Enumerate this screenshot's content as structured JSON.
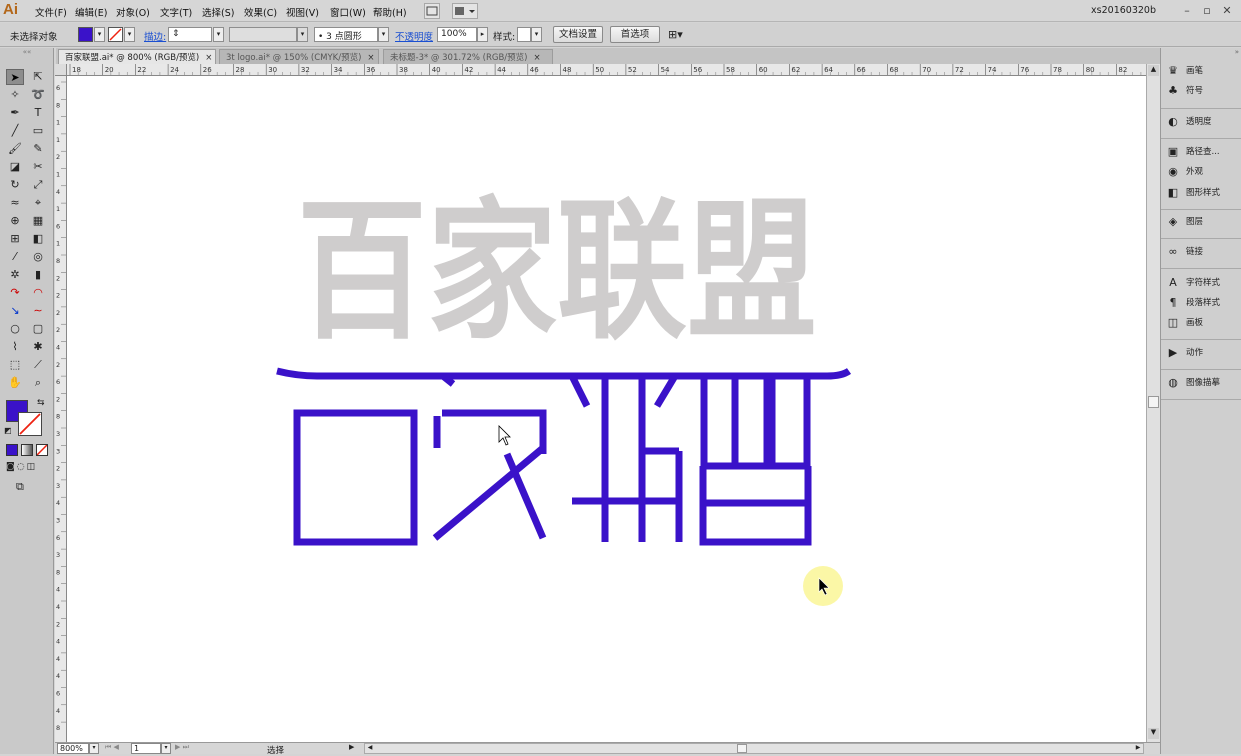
{
  "app": {
    "logo": "Ai",
    "user": "xs20160320b"
  },
  "menu": [
    "文件(F)",
    "编辑(E)",
    "对象(O)",
    "文字(T)",
    "选择(S)",
    "效果(C)",
    "视图(V)",
    "窗口(W)",
    "帮助(H)"
  ],
  "control": {
    "selection_status": "未选择对象",
    "stroke_label": "描边:",
    "brush_value": "3 点圆形",
    "opacity_label": "不透明度",
    "opacity_value": "100%",
    "style_label": "样式:",
    "doc_setup": "文档设置",
    "preferences": "首选项"
  },
  "tabs": [
    {
      "label": "百家联盟.ai* @ 800% (RGB/预览)",
      "active": true
    },
    {
      "label": "3t logo.ai* @ 150% (CMYK/预览)",
      "active": false
    },
    {
      "label": "未标题-3* @ 301.72% (RGB/预览)",
      "active": false
    }
  ],
  "ruler_top": [
    "18",
    "20",
    "22",
    "24",
    "26",
    "28",
    "30",
    "32",
    "34",
    "36",
    "38",
    "40",
    "42",
    "44",
    "46",
    "48",
    "50",
    "52",
    "54",
    "56",
    "58",
    "60",
    "62",
    "64",
    "66",
    "68",
    "70",
    "72",
    "74",
    "76",
    "78",
    "80",
    "82"
  ],
  "ruler_left": [
    "6",
    "8",
    "1",
    "1",
    "2",
    "1",
    "4",
    "1",
    "6",
    "1",
    "8",
    "2",
    "2",
    "2",
    "2",
    "4",
    "2",
    "6",
    "2",
    "8",
    "3",
    "3",
    "2",
    "3",
    "4",
    "3",
    "6",
    "3",
    "8",
    "4",
    "4",
    "2",
    "4",
    "4",
    "4",
    "6",
    "4",
    "8"
  ],
  "canvas": {
    "reference_text": "百家联盟",
    "colors": {
      "reference": "#cfcdcd",
      "logo": "#3a12c9",
      "cursor_halo": "#fbf7a6"
    }
  },
  "swatches": {
    "fill": "#3a12c9",
    "stroke": "none"
  },
  "status": {
    "zoom": "800%",
    "page": "1",
    "tool": "选择"
  },
  "right_panel": [
    {
      "icon": "brush-icon",
      "glyph": "♛",
      "label": "画笔"
    },
    {
      "icon": "symbol-icon",
      "glyph": "♣",
      "label": "符号"
    },
    {
      "icon": "transparency-icon",
      "glyph": "◐",
      "label": "透明度"
    },
    {
      "icon": "pathfinder-icon",
      "glyph": "▣",
      "label": "路径查..."
    },
    {
      "icon": "appearance-icon",
      "glyph": "◉",
      "label": "外观"
    },
    {
      "icon": "graphic-styles-icon",
      "glyph": "◧",
      "label": "图形样式"
    },
    {
      "icon": "layers-icon",
      "glyph": "◈",
      "label": "图层"
    },
    {
      "icon": "links-icon",
      "glyph": "∞",
      "label": "链接"
    },
    {
      "icon": "char-styles-icon",
      "glyph": "A",
      "label": "字符样式"
    },
    {
      "icon": "para-styles-icon",
      "glyph": "¶",
      "label": "段落样式"
    },
    {
      "icon": "artboards-icon",
      "glyph": "◫",
      "label": "画板"
    },
    {
      "icon": "actions-icon",
      "glyph": "▶",
      "label": "动作"
    },
    {
      "icon": "image-trace-icon",
      "glyph": "◍",
      "label": "图像描摹"
    }
  ]
}
